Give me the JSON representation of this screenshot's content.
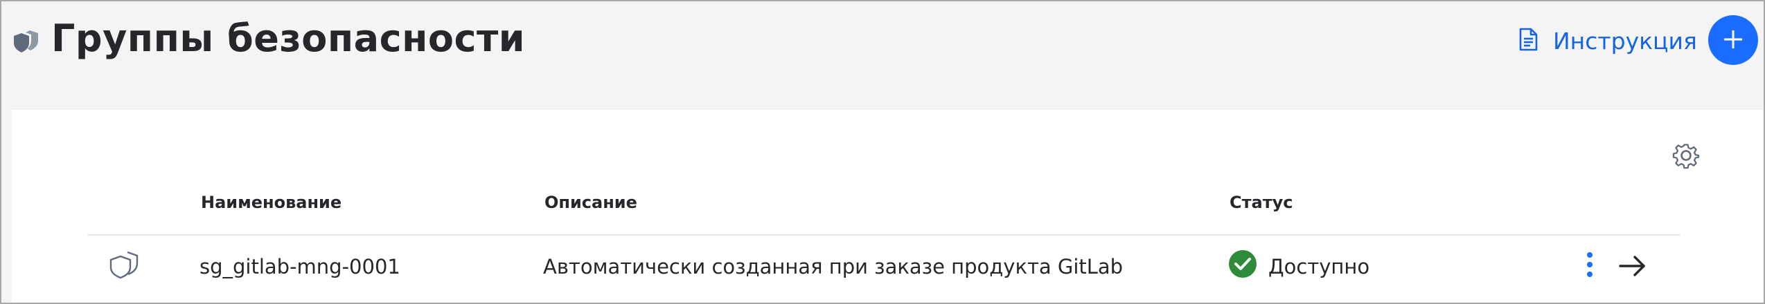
{
  "header": {
    "title": "Группы безопасности",
    "icon": "shields-icon",
    "instruction_label": "Инструкция",
    "instruction_icon": "document-icon",
    "add_icon": "plus-icon"
  },
  "table": {
    "settings_icon": "gear-icon",
    "columns": [
      "Наименование",
      "Описание",
      "Статус"
    ],
    "rows": [
      {
        "icon": "shield-icon",
        "name": "sg_gitlab-mng-0001",
        "description": "Автоматически созданная при заказе продукта GitLab",
        "status": "Доступно",
        "status_icon": "check-circle-icon",
        "menu_icon": "kebab-icon",
        "open_icon": "arrow-right-icon"
      }
    ]
  },
  "colors": {
    "accent": "#1a6dff",
    "link": "#1565e0",
    "status_ok": "#2e8b3a",
    "header_bg": "#f4f4f4",
    "icon_gray": "#5f6b7a"
  }
}
